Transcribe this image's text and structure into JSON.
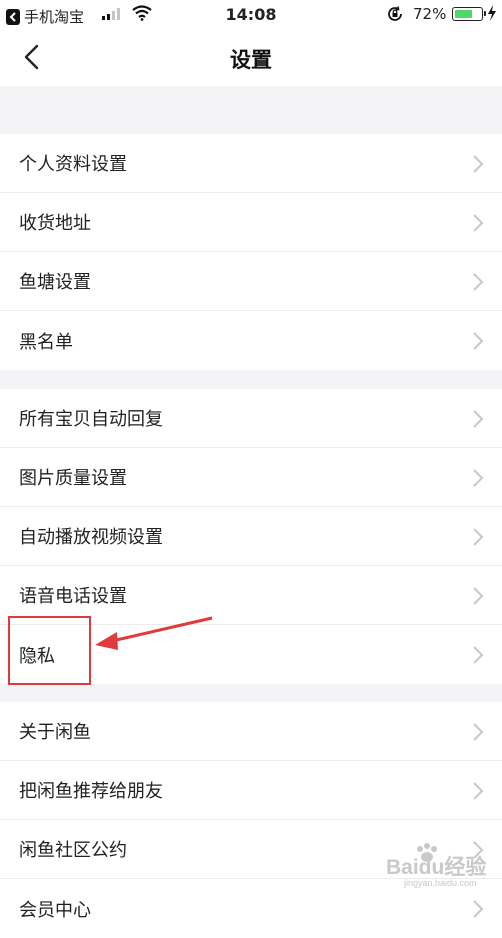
{
  "status_bar": {
    "back_app": "手机淘宝",
    "time": "14:08",
    "battery_percent": "72%",
    "battery_level": 0.72,
    "signal_bars": 4,
    "signal_active": 2
  },
  "nav": {
    "title": "设置",
    "back_icon": "chevron-left-icon"
  },
  "groups": [
    {
      "items": [
        "个人资料设置",
        "收货地址",
        "鱼塘设置",
        "黑名单"
      ]
    },
    {
      "items": [
        "所有宝贝自动回复",
        "图片质量设置",
        "自动播放视频设置",
        "语音电话设置",
        "隐私"
      ]
    },
    {
      "items": [
        "关于闲鱼",
        "把闲鱼推荐给朋友",
        "闲鱼社区公约",
        "会员中心"
      ]
    }
  ],
  "annotation": {
    "color": "#e03b3b"
  },
  "watermark": {
    "text": "Baidu经验",
    "subtext": "jingyan.baidu.com"
  },
  "colors": {
    "background": "#f4f4f6",
    "card": "#ffffff",
    "chevron": "#c7c7cc",
    "text": "#222222"
  }
}
